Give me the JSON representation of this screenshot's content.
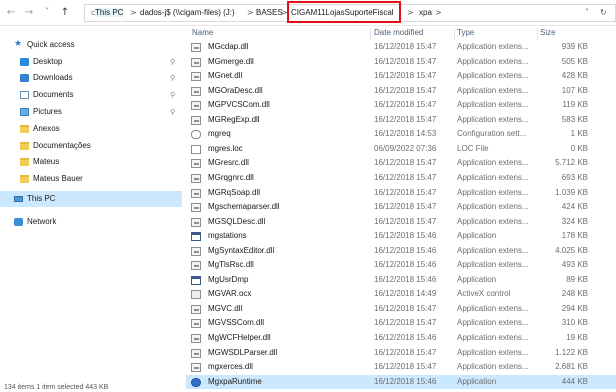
{
  "address": {
    "crumbs": [
      "This PC",
      "dados-j$ (\\\\cigam-files) (J:)",
      "BASES",
      "CIGAM11LojasSuporteFiscal",
      "xpa"
    ],
    "separator": ">",
    "nav_back": "←",
    "nav_forward": "→",
    "nav_recent": "˅",
    "nav_up": "↑",
    "dropdown": "˅",
    "refresh": "↻"
  },
  "navpane": {
    "items": [
      {
        "label": "Quick access",
        "icon": "quick-access-star-icon"
      },
      {
        "label": "Desktop",
        "icon": "desktop-icon"
      },
      {
        "label": "Downloads",
        "icon": "downloads-icon"
      },
      {
        "label": "Documents",
        "icon": "documents-icon"
      },
      {
        "label": "Pictures",
        "icon": "pictures-icon"
      },
      {
        "label": "Anexos",
        "icon": "folder-icon"
      },
      {
        "label": "Documentações",
        "icon": "folder-icon"
      },
      {
        "label": "Mateus",
        "icon": "folder-icon"
      },
      {
        "label": "Mateus Bauer",
        "icon": "folder-icon"
      },
      {
        "label": "This PC",
        "icon": "this-pc-icon"
      },
      {
        "label": "Network",
        "icon": "network-icon"
      }
    ],
    "pin_glyph": "📌"
  },
  "columns": {
    "name": "Name",
    "date": "Date modified",
    "type": "Type",
    "size": "Size"
  },
  "files": [
    {
      "name": "MGcdap.dll",
      "date": "16/12/2018 15:47",
      "type": "Application extens...",
      "size": "939 KB",
      "icon": "dll"
    },
    {
      "name": "MGmerge.dll",
      "date": "16/12/2018 15:47",
      "type": "Application extens...",
      "size": "505 KB",
      "icon": "dll"
    },
    {
      "name": "MGnet.dll",
      "date": "16/12/2018 15:47",
      "type": "Application extens...",
      "size": "428 KB",
      "icon": "dll"
    },
    {
      "name": "MGOraDesc.dll",
      "date": "16/12/2018 15:47",
      "type": "Application extens...",
      "size": "107 KB",
      "icon": "dll"
    },
    {
      "name": "MGPVCSCom.dll",
      "date": "16/12/2018 15:47",
      "type": "Application extens...",
      "size": "119 KB",
      "icon": "dll"
    },
    {
      "name": "MGRegExp.dll",
      "date": "16/12/2018 15:47",
      "type": "Application extens...",
      "size": "583 KB",
      "icon": "dll"
    },
    {
      "name": "mgreq",
      "date": "16/12/2018 14:53",
      "type": "Configuration sett...",
      "size": "1 KB",
      "icon": "cfg"
    },
    {
      "name": "mgres.loc",
      "date": "06/09/2022 07:36",
      "type": "LOC File",
      "size": "0 KB",
      "icon": "file"
    },
    {
      "name": "MGresrc.dll",
      "date": "16/12/2018 15:47",
      "type": "Application extens...",
      "size": "5.712 KB",
      "icon": "dll"
    },
    {
      "name": "MGrqgnrc.dll",
      "date": "16/12/2018 15:47",
      "type": "Application extens...",
      "size": "693 KB",
      "icon": "dll"
    },
    {
      "name": "MGRqSoap.dll",
      "date": "16/12/2018 15:47",
      "type": "Application extens...",
      "size": "1.039 KB",
      "icon": "dll"
    },
    {
      "name": "Mgschemaparser.dll",
      "date": "16/12/2018 15:47",
      "type": "Application extens...",
      "size": "424 KB",
      "icon": "dll"
    },
    {
      "name": "MGSQLDesc.dll",
      "date": "16/12/2018 15:47",
      "type": "Application extens...",
      "size": "324 KB",
      "icon": "dll"
    },
    {
      "name": "mgstations",
      "date": "16/12/2018 15:46",
      "type": "Application",
      "size": "178 KB",
      "icon": "app"
    },
    {
      "name": "MgSyntaxEditor.dll",
      "date": "16/12/2018 15:46",
      "type": "Application extens...",
      "size": "4.025 KB",
      "icon": "dll"
    },
    {
      "name": "MgTlsRsc.dll",
      "date": "16/12/2018 15:46",
      "type": "Application extens...",
      "size": "493 KB",
      "icon": "dll"
    },
    {
      "name": "MgUsrDmp",
      "date": "16/12/2018 15:46",
      "type": "Application",
      "size": "89 KB",
      "icon": "app"
    },
    {
      "name": "MGVAR.ocx",
      "date": "16/12/2018 14:49",
      "type": "ActiveX control",
      "size": "248 KB",
      "icon": "ocx"
    },
    {
      "name": "MGVC.dll",
      "date": "16/12/2018 15:47",
      "type": "Application extens...",
      "size": "294 KB",
      "icon": "dll"
    },
    {
      "name": "MGVSSCom.dll",
      "date": "16/12/2018 15:47",
      "type": "Application extens...",
      "size": "310 KB",
      "icon": "dll"
    },
    {
      "name": "MgWCFHelper.dll",
      "date": "16/12/2018 15:46",
      "type": "Application extens...",
      "size": "19 KB",
      "icon": "dll"
    },
    {
      "name": "MGWSDLParser.dll",
      "date": "16/12/2018 15:47",
      "type": "Application extens...",
      "size": "1.122 KB",
      "icon": "dll"
    },
    {
      "name": "mgxerces.dll",
      "date": "16/12/2018 15:47",
      "type": "Application extens...",
      "size": "2.681 KB",
      "icon": "dll"
    },
    {
      "name": "MgxpaRuntime",
      "date": "16/12/2018 15:46",
      "type": "Application",
      "size": "444 KB",
      "icon": "run",
      "selected": true
    }
  ],
  "status": {
    "text": "134 items   1 item selected   443 KB"
  },
  "colors": {
    "selection": "#cce8ff",
    "highlight_box": "#e0101a",
    "accent": "#2b7bd1"
  }
}
